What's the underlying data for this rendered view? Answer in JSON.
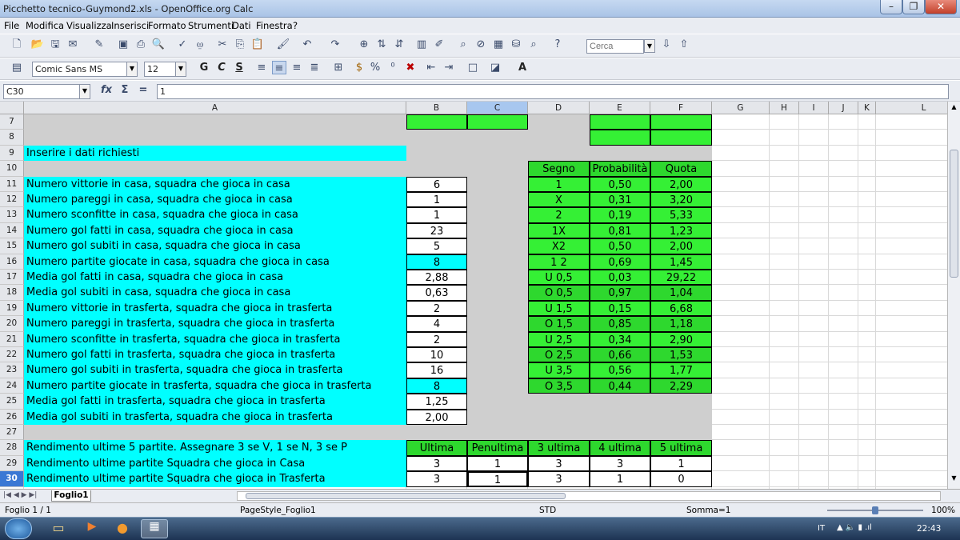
{
  "window": {
    "title": "Picchetto tecnico-Guymond2.xls - OpenOffice.org Calc"
  },
  "menu": [
    "File",
    "Modifica",
    "Visualizza",
    "Inserisci",
    "Formato",
    "Strumenti",
    "Dati",
    "Finestra",
    "?"
  ],
  "toolbar": {
    "search_placeholder": "Cerca"
  },
  "format": {
    "font_name": "Comic Sans MS",
    "font_size": "12",
    "bold": "G",
    "italic": "C",
    "underline": "S"
  },
  "formula": {
    "cell_ref": "C30",
    "value": "1"
  },
  "columns": [
    "A",
    "B",
    "C",
    "D",
    "E",
    "F",
    "G",
    "H",
    "I",
    "J",
    "K",
    "L"
  ],
  "rows": [
    "7",
    "8",
    "9",
    "10",
    "11",
    "12",
    "13",
    "14",
    "15",
    "16",
    "17",
    "18",
    "19",
    "20",
    "21",
    "22",
    "23",
    "24",
    "25",
    "26",
    "27",
    "28",
    "29",
    "30"
  ],
  "labels": {
    "r9": "Inserire i dati richiesti",
    "input_labels": [
      "Numero vittorie in casa, squadra che gioca in casa",
      "Numero pareggi in casa, squadra che gioca in casa",
      "Numero sconfitte in casa, squadra che gioca in casa",
      "Numero gol fatti in casa, squadra che gioca in casa",
      "Numero gol subiti in casa, squadra che gioca in casa",
      "Numero partite giocate in casa, squadra che gioca in casa",
      "Media gol fatti in casa, squadra che gioca in casa",
      "Media gol subiti in casa, squadra che gioca in casa",
      "Numero vittorie in trasferta, squadra che gioca in trasferta",
      "Numero pareggi in trasferta, squadra che gioca in trasferta",
      "Numero sconfitte in trasferta, squadra che gioca in trasferta",
      "Numero gol fatti in trasferta, squadra che gioca in trasferta",
      "Numero gol subiti in trasferta, squadra che gioca in trasferta",
      "Numero partite giocate in trasferta, squadra che gioca in trasferta",
      "Media gol fatti in trasferta, squadra che gioca in trasferta",
      "Media gol subiti in trasferta, squadra che gioca in trasferta"
    ],
    "input_values": [
      "6",
      "1",
      "1",
      "23",
      "5",
      "8",
      "2,88",
      "0,63",
      "2",
      "4",
      "2",
      "10",
      "16",
      "8",
      "1,25",
      "2,00"
    ],
    "r28": "Rendimento ultime 5 partite. Assegnare 3 se V, 1 se N, 3 se P",
    "r29": "Rendimento ultime partite Squadra che gioca in Casa",
    "r30": "Rendimento ultime partite Squadra che gioca in Trasferta"
  },
  "odds_table": {
    "headers": [
      "Segno",
      "Probabilità",
      "Quota"
    ],
    "rows": [
      [
        "1",
        "0,50",
        "2,00"
      ],
      [
        "X",
        "0,31",
        "3,20"
      ],
      [
        "2",
        "0,19",
        "5,33"
      ],
      [
        "1X",
        "0,81",
        "1,23"
      ],
      [
        "X2",
        "0,50",
        "2,00"
      ],
      [
        "1 2",
        "0,69",
        "1,45"
      ],
      [
        "U 0,5",
        "0,03",
        "29,22"
      ],
      [
        "O 0,5",
        "0,97",
        "1,04"
      ],
      [
        "U 1,5",
        "0,15",
        "6,68"
      ],
      [
        "O 1,5",
        "0,85",
        "1,18"
      ],
      [
        "U 2,5",
        "0,34",
        "2,90"
      ],
      [
        "O 2,5",
        "0,66",
        "1,53"
      ],
      [
        "U 3,5",
        "0,56",
        "1,77"
      ],
      [
        "O 3,5",
        "0,44",
        "2,29"
      ]
    ]
  },
  "rendimento": {
    "headers": [
      "Ultima",
      "Penultima",
      "3 ultima",
      "4 ultima",
      "5 ultima"
    ],
    "casa": [
      "3",
      "1",
      "3",
      "3",
      "1"
    ],
    "trasferta": [
      "3",
      "1",
      "3",
      "1",
      "0"
    ]
  },
  "sheet_tab": "Foglio1",
  "status": {
    "sheet": "Foglio 1 / 1",
    "page_style": "PageStyle_Foglio1",
    "mode": "STD",
    "sum": "Somma=1",
    "zoom": "100%"
  },
  "taskbar": {
    "lang": "IT",
    "time": "22:43"
  },
  "colors": {
    "cyan": "#00ffff",
    "lime": "#35f035",
    "green": "#2ed82e",
    "selection": "#3b78d4"
  }
}
